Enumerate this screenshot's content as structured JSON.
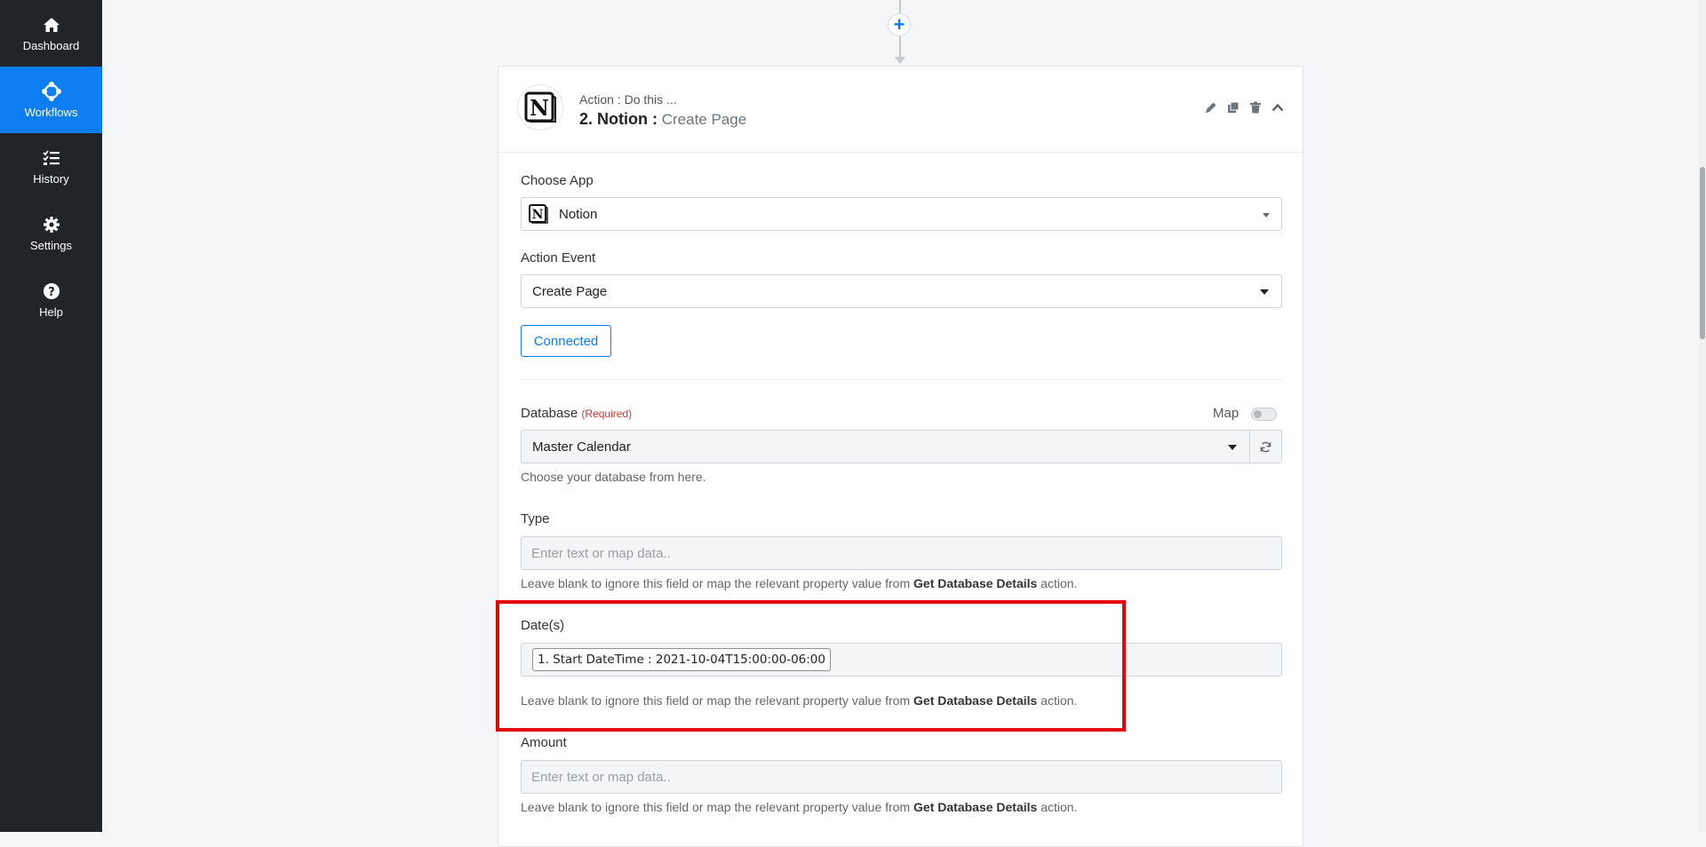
{
  "sidebar": {
    "items": [
      {
        "label": "Dashboard",
        "icon": "home-icon"
      },
      {
        "label": "Workflows",
        "icon": "workflow-icon",
        "active": true
      },
      {
        "label": "History",
        "icon": "history-list-icon"
      },
      {
        "label": "Settings",
        "icon": "gear-icon"
      },
      {
        "label": "Help",
        "icon": "question-icon"
      }
    ]
  },
  "flow": {
    "add_step": "+"
  },
  "step": {
    "subtitle": "Action : Do this ...",
    "number_app": "2. Notion :",
    "event": " Create Page"
  },
  "form": {
    "choose_app_label": "Choose App",
    "choose_app_value": "Notion",
    "action_event_label": "Action Event",
    "action_event_value": "Create Page",
    "connected_label": "Connected",
    "database": {
      "label": "Database",
      "required": "(Required)",
      "map_label": "Map",
      "value": "Master Calendar",
      "help": "Choose your database from here."
    },
    "help_prefix": "Leave blank to ignore this field or map the relevant property value from ",
    "help_bold": "Get Database Details",
    "help_suffix": " action.",
    "type": {
      "label": "Type",
      "placeholder": "Enter text or map data.."
    },
    "dates": {
      "label": "Date(s)",
      "token": "1. Start DateTime : 2021-10-04T15:00:00-06:00"
    },
    "amount": {
      "label": "Amount",
      "placeholder": "Enter text or map data.."
    }
  },
  "colors": {
    "accent": "#0d7ef2",
    "sidebar": "#212529",
    "highlight": "#e3070d"
  }
}
